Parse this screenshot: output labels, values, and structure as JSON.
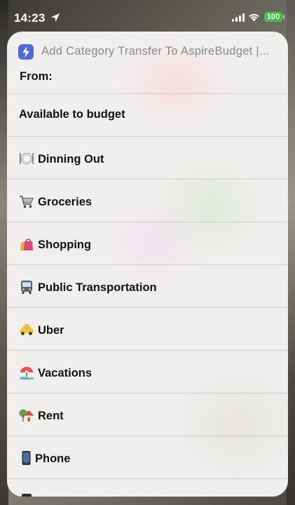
{
  "status_bar": {
    "time": "14:23",
    "battery": "100",
    "battery_color": "#3ec24a"
  },
  "shortcut": {
    "title": "Add Category Transfer To AspireBudget |...",
    "icon": "shortcuts-bolt-icon",
    "accent": "#4a6bd8"
  },
  "prompt": {
    "label": "From:"
  },
  "options": [
    {
      "emoji": "",
      "label": "Available to budget"
    },
    {
      "emoji": "fork-plate-icon",
      "label": "Dinning Out"
    },
    {
      "emoji": "shopping-cart-icon",
      "label": "Groceries"
    },
    {
      "emoji": "shopping-bags-icon",
      "label": "Shopping"
    },
    {
      "emoji": "bus-icon",
      "label": "Public Transportation"
    },
    {
      "emoji": "taxi-icon",
      "label": "Uber"
    },
    {
      "emoji": "beach-umbrella-icon",
      "label": "Vacations"
    },
    {
      "emoji": "house-icon",
      "label": "Rent"
    },
    {
      "emoji": "mobile-phone-icon",
      "label": "Phone"
    }
  ]
}
